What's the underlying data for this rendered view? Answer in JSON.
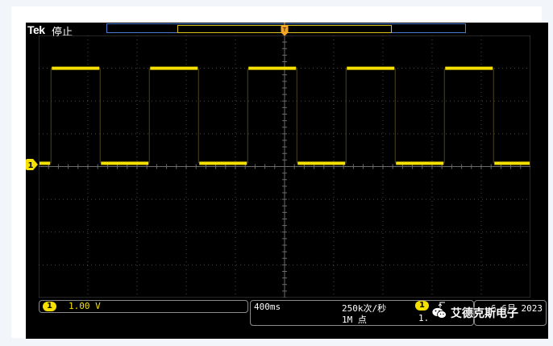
{
  "header": {
    "brand": "Tek",
    "state": "停止"
  },
  "display": {
    "background": "#000000",
    "grid_color": "#4a4a4a",
    "trace_color": "#f5e000",
    "record_bar_color": "#4a7bd0",
    "trigger_marker_color": "#f5a623"
  },
  "waveform": {
    "channel": "1",
    "type": "square",
    "levels": {
      "high_div": 3,
      "low_div": 0.1
    },
    "transition_times_div": [
      0.25,
      1.25,
      2.25,
      3.25,
      4.25,
      5.25,
      6.25,
      7.25,
      8.25,
      9.25
    ],
    "initial_state": "low"
  },
  "status": {
    "channel_badge": "1",
    "channel_scale": "1.00 V",
    "horizontal_scale": "400ms",
    "sample_rate": "250k次/秒",
    "record_length": "1M 点",
    "trigger_badge": "1",
    "trigger_text": "1.",
    "trigger_slope_icon": "rising-edge",
    "date": "6 6月 2023"
  },
  "watermark": {
    "text": "艾德克斯电子",
    "icon": "wechat-icon"
  }
}
